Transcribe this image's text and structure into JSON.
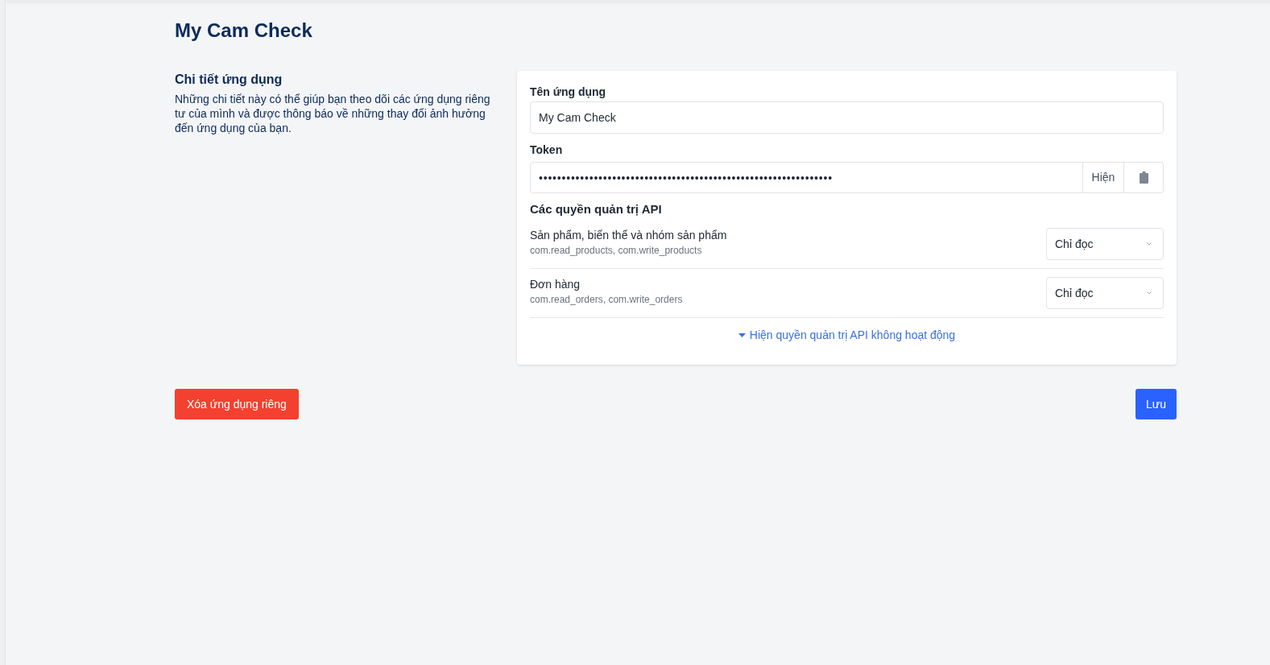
{
  "page": {
    "title": "My Cam Check"
  },
  "details": {
    "heading": "Chi tiết ứng dụng",
    "description": "Những chi tiết này có thể giúp bạn theo dõi các ứng dụng riêng tư của mình và được thông báo về những thay đổi ảnh hưởng đến ứng dụng của bạn."
  },
  "form": {
    "app_name": {
      "label": "Tên ứng dụng",
      "value": "My Cam Check"
    },
    "token": {
      "label": "Token",
      "value": "••••••••••••••••••••••••••••••••••••••••••••••••••••••••••••••••",
      "show_button": "Hiện"
    },
    "permissions": {
      "heading": "Các quyền quản trị API",
      "items": [
        {
          "name": "Sản phẩm, biến thể và nhóm sản phẩm",
          "scopes": "com.read_products, com.write_products",
          "access": "Chỉ đọc"
        },
        {
          "name": "Đơn hàng",
          "scopes": "com.read_orders, com.write_orders",
          "access": "Chỉ đọc"
        }
      ]
    },
    "toggle_link": "Hiện quyền quản trị API không hoạt động"
  },
  "actions": {
    "delete": "Xóa ứng dụng riêng",
    "save": "Lưu"
  }
}
